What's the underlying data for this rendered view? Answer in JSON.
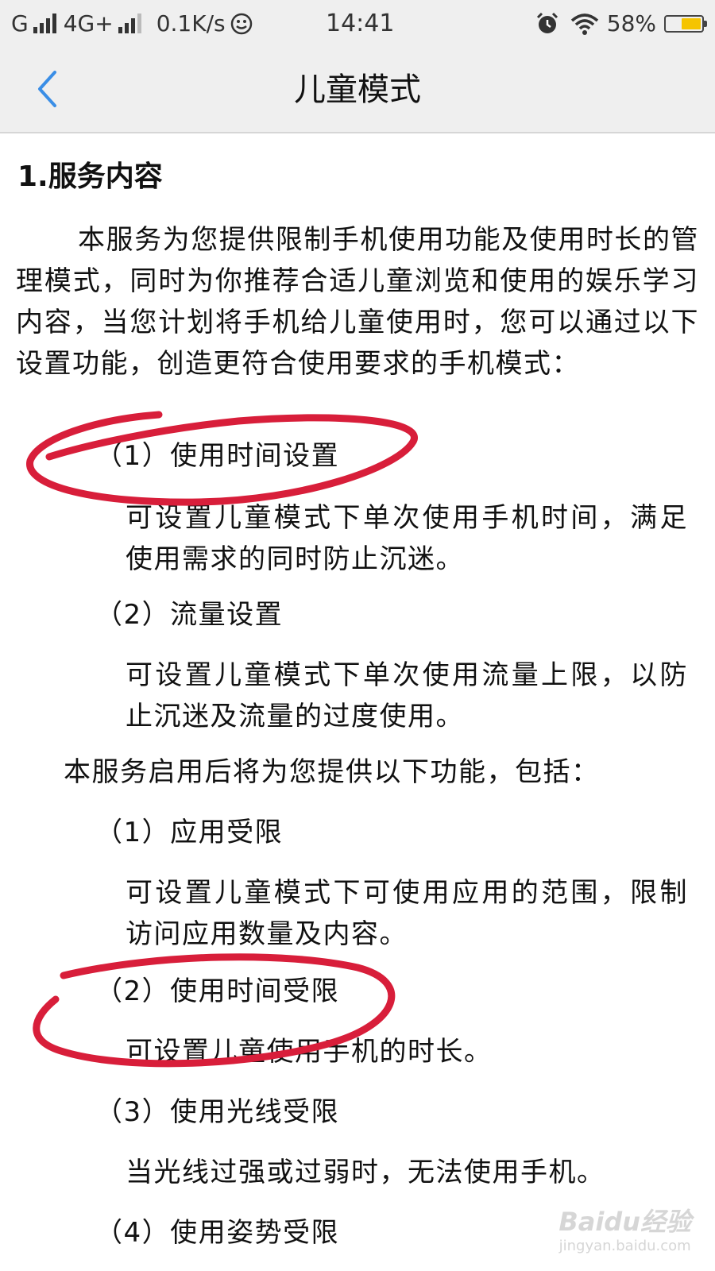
{
  "status_bar": {
    "carrier": "G",
    "network": "4G+",
    "speed": "0.1K/s",
    "time": "14:41",
    "battery": "58%",
    "battery_level": 0.58
  },
  "nav": {
    "title": "儿童模式",
    "back_icon": "chevron-left-icon",
    "accent": "#3a8ee6"
  },
  "content": {
    "section_heading": "1.服务内容",
    "intro": "本服务为您提供限制手机使用功能及使用时长的管理模式，同时为你推荐合适儿童浏览和使用的娱乐学习内容，当您计划将手机给儿童使用时，您可以通过以下设置功能，创造更符合使用要求的手机模式：",
    "settings": [
      {
        "title": "（1）使用时间设置",
        "desc": "可设置儿童模式下单次使用手机时间，满足使用需求的同时防止沉迷。"
      },
      {
        "title": "（2）流量设置",
        "desc": "可设置儿童模式下单次使用流量上限，以防止沉迷及流量的过度使用。"
      }
    ],
    "features_intro": "本服务启用后将为您提供以下功能，包括：",
    "features": [
      {
        "title": "（1）应用受限",
        "desc": "可设置儿童模式下可使用应用的范围，限制访问应用数量及内容。"
      },
      {
        "title": "（2）使用时间受限",
        "desc": "可设置儿童使用手机的时长。"
      },
      {
        "title": "（3）使用光线受限",
        "desc": "当光线过强或过弱时，无法使用手机。"
      },
      {
        "title": "（4）使用姿势受限"
      }
    ]
  },
  "annotation_color": "#d81e3a",
  "watermark": {
    "brand": "Baidu经验",
    "url": "jingyan.baidu.com"
  }
}
